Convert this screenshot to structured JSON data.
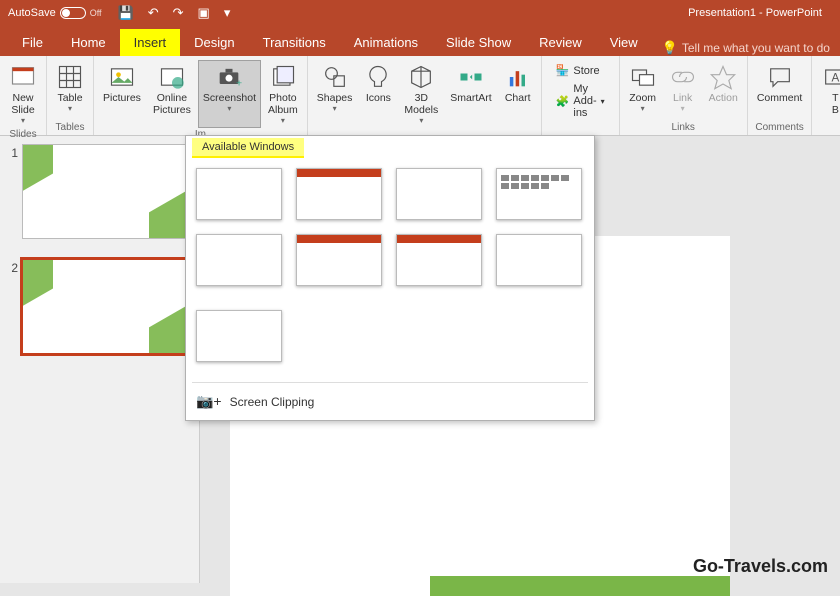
{
  "titlebar": {
    "autosave_label": "AutoSave",
    "autosave_state": "Off",
    "doc_title": "Presentation1 - PowerPoint"
  },
  "qat": {
    "save": "save-icon",
    "undo": "undo-icon",
    "redo": "redo-icon",
    "present": "present-from-start-icon",
    "more": "more-icon"
  },
  "tabs": {
    "file": "File",
    "home": "Home",
    "insert": "Insert",
    "design": "Design",
    "transitions": "Transitions",
    "animations": "Animations",
    "slide_show": "Slide Show",
    "review": "Review",
    "view": "View",
    "tell_me": "Tell me what you want to do"
  },
  "ribbon": {
    "groups": {
      "slides": {
        "label": "Slides",
        "new_slide": "New\nSlide"
      },
      "tables": {
        "label": "Tables",
        "table": "Table"
      },
      "images": {
        "label": "Im",
        "pictures": "Pictures",
        "online_pictures": "Online\nPictures",
        "screenshot": "Screenshot",
        "photo_album": "Photo\nAlbum"
      },
      "illustrations": {
        "shapes": "Shapes",
        "icons": "Icons",
        "models3d": "3D\nModels",
        "smartart": "SmartArt",
        "chart": "Chart"
      },
      "addins": {
        "store": "Store",
        "my_addins": "My Add-ins"
      },
      "links": {
        "label": "Links",
        "zoom": "Zoom",
        "link": "Link",
        "action": "Action"
      },
      "comments": {
        "label": "Comments",
        "comment": "Comment"
      },
      "text_trunc": "T\nB"
    }
  },
  "dropdown": {
    "header": "Available Windows",
    "screen_clipping": "Screen Clipping",
    "window_count": 9
  },
  "thumbnails": {
    "items": [
      {
        "num": "1",
        "selected": false
      },
      {
        "num": "2",
        "selected": true
      }
    ]
  },
  "watermark": "Go-Travels.com"
}
